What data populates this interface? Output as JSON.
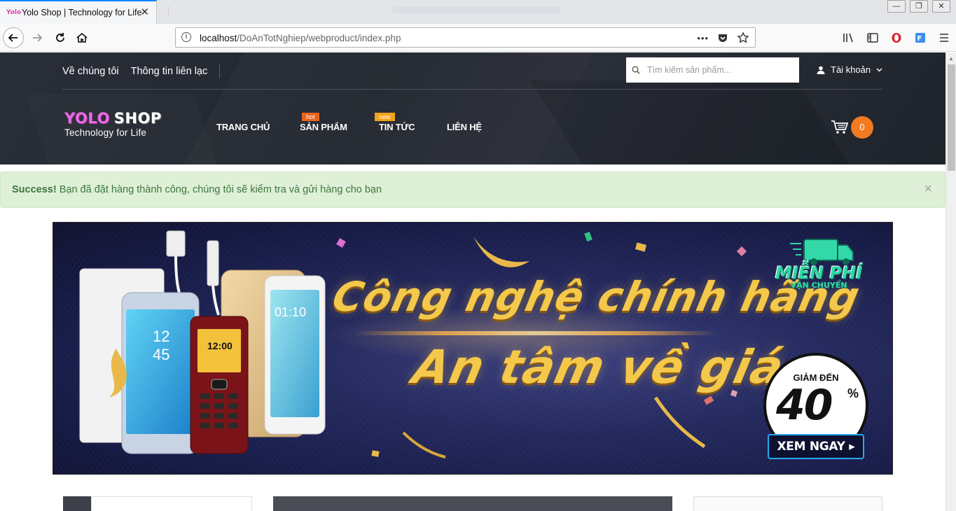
{
  "browser": {
    "tab_title": "Yolo Shop | Technology for Life",
    "tab_logo_text": "Yolo",
    "close_glyph": "✕",
    "url_host": "localhost",
    "url_path": "/DoAnTotNghiep/webproduct/index.php",
    "url_more_glyph": "•••",
    "minimize_glyph": "—",
    "restore_glyph": "❐",
    "close_window_glyph": "✕"
  },
  "header": {
    "top_links": [
      "Về chúng tôi",
      "Thông tin liên lạc"
    ],
    "search_placeholder": "Tìm kiếm sản phẩm...",
    "account_label": "Tài khoản",
    "logo_yolo": "YOLO",
    "logo_shop": "SHOP",
    "logo_tagline": "Technology for Life",
    "nav": [
      "TRANG CHỦ",
      "SẢN PHẨM",
      "TIN TỨC",
      "LIÊN HỆ"
    ],
    "badges": {
      "hot": "hot",
      "new": "new"
    },
    "cart_count": "0"
  },
  "alert": {
    "strong": "Success!",
    "message": " Bạn đã đặt hàng thành công, chúng tôi sẽ kiểm tra và gửi hàng cho bạn",
    "close": "×"
  },
  "banner": {
    "line1": "Công nghệ chính hãng",
    "line2": "An tâm về giá",
    "free_ship_1": "MIỄN PHÍ",
    "free_ship_2": "VẬN CHUYỂN",
    "discount_label": "GIẢM ĐẾN",
    "discount_value": "40",
    "discount_unit": "%",
    "cta": "XEM NGAY ▸",
    "phone_time_1": "12:00",
    "phone_time_2": "01:10",
    "phone_time_3": "12",
    "phone_time_4": "45"
  },
  "colors": {
    "header_bg": "#262a33",
    "accent_orange": "#f47a20",
    "alert_bg": "#dff0d8",
    "alert_text": "#3c763d"
  }
}
